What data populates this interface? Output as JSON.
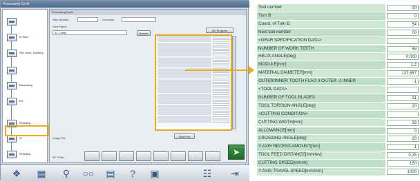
{
  "window": {
    "title": "Processing Cycle"
  },
  "colors": {
    "highlight": "#f2a81d",
    "detail_row_bg": "#cfe8d6",
    "detail_row_alt_bg": "#bfdfc8",
    "detail_text": "#1f3a3a",
    "go_button": "#2f8a3e"
  },
  "left_steps": [
    {
      "label": ""
    },
    {
      "label": "M Start"
    },
    {
      "label": "Std. Work, Leveling"
    },
    {
      "label": ""
    },
    {
      "label": "Measuring"
    },
    {
      "label": "M1"
    },
    {
      "label": "Finishing"
    },
    {
      "label": "W"
    },
    {
      "label": "Finishing"
    }
  ],
  "main": {
    "header": "Processing Cycle",
    "step_no_label": "Step Number",
    "comment_label": "Comment",
    "gear_name_label": "Gear Name",
    "gear_name_value": "Z1 1-step",
    "browse_button": "Browse",
    "nc_program_button": "NC Program",
    "image_file_label": "Image File",
    "nc_code_label": "NC Code",
    "start_button": "Start Pos",
    "go_icon": "execute-icon"
  },
  "toolbar": {
    "icons": [
      "network-icon",
      "grid-icon",
      "zoom-icon",
      "binoculars-icon",
      "document-icon",
      "help-icon",
      "screen-icon",
      "calculator-icon",
      "exit-icon"
    ]
  },
  "detail": {
    "rows": [
      {
        "label": "Tool number",
        "value": "00"
      },
      {
        "label": "Turn B",
        "value": "0"
      },
      {
        "label": "Coord. of Turn B",
        "value": "54"
      },
      {
        "label": "Next tool number",
        "value": "00"
      },
      {
        "label": "<GEAR SPECIFICATION DATA>",
        "value": ""
      },
      {
        "label": "NUMBER OF WORK TEETH",
        "value": "59"
      },
      {
        "label": "HELIX ANGLE[deg]",
        "value": "0.000"
      },
      {
        "label": "MODULE[mm]",
        "value": "1.2"
      },
      {
        "label": "MATERIAL DIAMETER[mm]",
        "value": "137.557"
      },
      {
        "label": "OUTER/INNER TOOTH FLAG 0 OUTER -1 INNER",
        "value": "-1"
      },
      {
        "label": "<TOOL DATA>",
        "value": ""
      },
      {
        "label": "NUMBER OF TOOL BLADES",
        "value": "31"
      },
      {
        "label": "TOOL TORSION ANGLE[deg]",
        "value": "20"
      },
      {
        "label": "<CUTTING CONDITION>",
        "value": ""
      },
      {
        "label": "CUTTING WIDTH[mm]",
        "value": "33"
      },
      {
        "label": "ALLOWANCE[mm]",
        "value": "0"
      },
      {
        "label": "CROSSING ANGLE[deg]",
        "value": "20"
      },
      {
        "label": "Y AXIS RECESS AMOUNT[mm]",
        "value": "1"
      },
      {
        "label": "TOOL FEED DISTANCE[mm/rev]",
        "value": "0.15"
      },
      {
        "label": "CUTTING SPEED[m/min]",
        "value": "150"
      },
      {
        "label": "Y AXIS TRAVEL SPEED[mm/min]",
        "value": "1000"
      }
    ]
  }
}
